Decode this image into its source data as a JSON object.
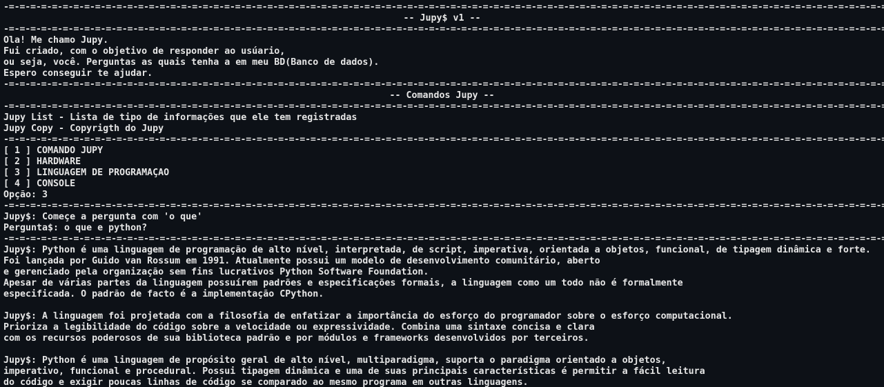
{
  "terminal": {
    "rule": "-=-=-=-=-=-=-=-=-=-=-=-=-=-=-=-=-=-=-=-=-=-=-=-=-=-=-=-=-=-=-=-=-=-=-=-=-=-=-=-=-=-=-=-=-=-=-=-=-=-=-=-=-=-=-=-=-=-=-=-=-=-=-=-=-=-=-=-=-=-=-=-=-=-=-=-=-=-=-=-=-=-=-=-=-=-=-=-=-=-=-=-=-=-=-=-=-=-=-=-=-=-=-=-=-=",
    "title": "-- Jupy$ v1 --",
    "intro": [
      "Ola! Me chamo Jupy.",
      "Fui criado, com o objetivo de responder ao usúario,",
      "ou seja, você. Perguntas as quais tenha a em meu BD(Banco de dados).",
      "Espero conseguir te ajudar."
    ],
    "commands_title": "-- Comandos Jupy --",
    "commands": [
      "Jupy List - Lista de tipo de informações que ele tem registradas",
      "Jupy Copy - Copyrigth do Jupy"
    ],
    "menu": [
      "[ 1 ] COMANDO JUPY",
      "[ 2 ] HARDWARE",
      "[ 3 ] LINGUAGEM DE PROGRAMAÇAO",
      "[ 4 ] CONSOLE"
    ],
    "option": "Opção: 3",
    "prompt": [
      "Jupy$: Começe a pergunta com 'o que'",
      "Pergunta$: o que e python?"
    ],
    "answer1": [
      "Jupy$: Python é uma linguagem de programação de alto nível, interpretada, de script, imperativa, orientada a objetos, funcional, de tipagem dinâmica e forte.",
      "Foi lançada por Guido van Rossum em 1991. Atualmente possui um modelo de desenvolvimento comunitário, aberto",
      "e gerenciado pela organização sem fins lucrativos Python Software Foundation.",
      "Apesar de várias partes da linguagem possuírem padrões e especificações formais, a linguagem como um todo não é formalmente",
      "especificada. O padrão de facto é a implementação CPython."
    ],
    "answer2": [
      "Jupy$: A linguagem foi projetada com a filosofia de enfatizar a importância do esforço do programador sobre o esforço computacional.",
      "Prioriza a legibilidade do código sobre a velocidade ou expressividade. Combina uma sintaxe concisa e clara",
      "com os recursos poderosos de sua biblioteca padrão e por módulos e frameworks desenvolvidos por terceiros."
    ],
    "answer3": [
      "Jupy$: Python é uma linguagem de propósito geral de alto nível, multiparadigma, suporta o paradigma orientado a objetos,",
      "imperativo, funcional e procedural. Possui tipagem dinâmica e uma de suas principais características é permitir a fácil leitura",
      "do código e exigir poucas linhas de código se comparado ao mesmo programa em outras linguagens."
    ]
  }
}
